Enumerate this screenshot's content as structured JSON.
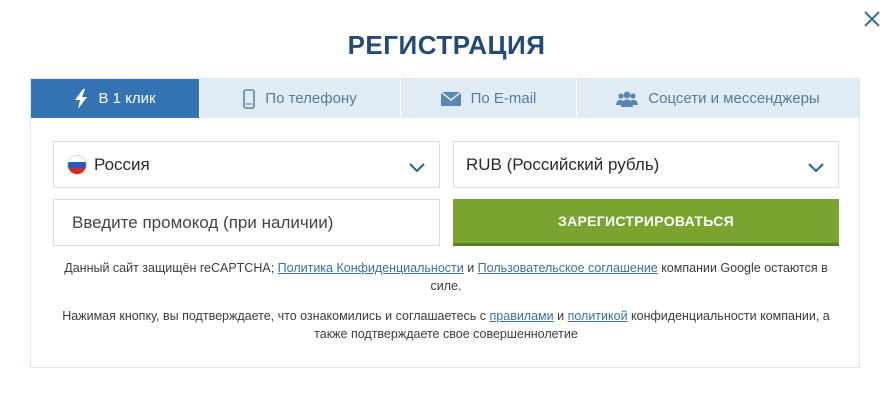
{
  "dialog": {
    "title": "РЕГИСТРАЦИЯ"
  },
  "tabs": [
    {
      "label": "В 1 клик",
      "icon": "lightning-icon",
      "active": true
    },
    {
      "label": "По телефону",
      "icon": "phone-icon",
      "active": false
    },
    {
      "label": "По E-mail",
      "icon": "mail-icon",
      "active": false
    },
    {
      "label": "Соцсети и мессенджеры",
      "icon": "users-icon",
      "active": false
    }
  ],
  "form": {
    "country": {
      "value": "Россия",
      "icon": "russia-flag-icon"
    },
    "currency": {
      "value": "RUB (Российский рубль)"
    },
    "promo": {
      "placeholder": "Введите промокод (при наличии)"
    },
    "submit_label": "ЗАРЕГИСТРИРОВАТЬСЯ"
  },
  "notes": {
    "recaptcha": {
      "prefix": "Данный сайт защищён reCAPTCHA; ",
      "privacy_link": "Политика Конфиденциальности",
      "and": " и ",
      "terms_link": "Пользовательское соглашение",
      "suffix": " компании Google остаются в силе."
    },
    "consent": {
      "prefix": "Нажимая кнопку, вы подтверждаете, что ознакомились и соглашаетесь с ",
      "rules_link": "правилами",
      "and": " и ",
      "policy_link": "политикой",
      "suffix": " конфиденциальности компании, а также подтверждаете свое совершеннолетие"
    }
  },
  "colors": {
    "title": "#234a78",
    "tab_active": "#3574b4",
    "tab_inactive_bg": "#e1ebf4",
    "tab_inactive_text": "#557aa0",
    "button_green": "#7aa32f",
    "link": "#3c6fa3"
  }
}
